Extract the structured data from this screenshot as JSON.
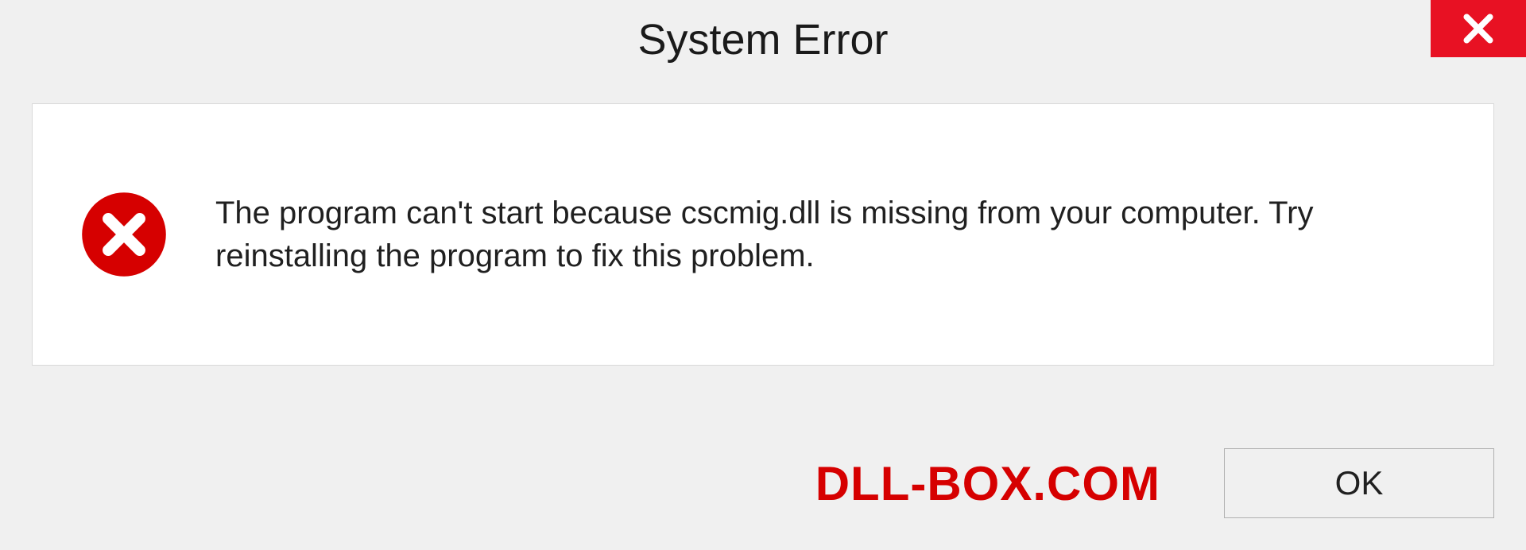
{
  "dialog": {
    "title": "System Error",
    "message": "The program can't start because cscmig.dll is missing from your computer. Try reinstalling the program to fix this problem.",
    "ok_label": "OK"
  },
  "watermark": "DLL-BOX.COM",
  "colors": {
    "close_bg": "#e81123",
    "error_icon": "#d60000",
    "watermark": "#d60000"
  }
}
